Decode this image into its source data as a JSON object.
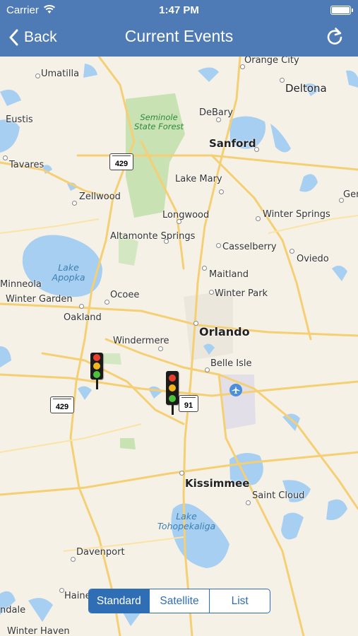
{
  "status_bar": {
    "carrier": "Carrier",
    "time": "1:47 PM"
  },
  "nav": {
    "back_label": "Back",
    "title": "Current Events"
  },
  "map": {
    "cities": {
      "orange_city": "Orange City",
      "deltona": "Deltona",
      "umatilla": "Umatilla",
      "eustis": "Eustis",
      "debary": "DeBary",
      "sanford": "Sanford",
      "tavares": "Tavares",
      "lake_mary": "Lake Mary",
      "zellwood": "Zellwood",
      "longwood": "Longwood",
      "winter_springs": "Winter Springs",
      "altamonte_springs": "Altamonte Springs",
      "casselberry": "Casselberry",
      "oviedo": "Oviedo",
      "maitland": "Maitland",
      "winter_park": "Winter Park",
      "ocoee": "Ocoee",
      "minneola": "Minneola",
      "winter_garden": "Winter Garden",
      "oakland": "Oakland",
      "orlando": "Orlando",
      "windermere": "Windermere",
      "belle_isle": "Belle Isle",
      "kissimmee": "Kissimmee",
      "saint_cloud": "Saint Cloud",
      "davenport": "Davenport",
      "haines": "Haine",
      "dale": "ndale",
      "winter_haven": "Winter Haven",
      "gen": "Gen"
    },
    "parks": {
      "seminole": "Seminole\nState Forest"
    },
    "waters": {
      "apopka": "Lake\nApopka",
      "toho": "Lake\nTohopekaliga"
    },
    "shields": {
      "s429_north": "429",
      "s429_west": "429",
      "s91": "91"
    }
  },
  "events": [
    {
      "name": "Traffic signal event",
      "lamps": [
        "#e8402f",
        "#f2b51c",
        "#4cc13c"
      ]
    },
    {
      "name": "Traffic signal event",
      "lamps": [
        "#e8402f",
        "#f2b51c",
        "#4cc13c"
      ]
    }
  ],
  "segmented": {
    "options": [
      "Standard",
      "Satellite",
      "List"
    ],
    "selected": "Standard"
  },
  "colors": {
    "nav": "#4e7bb5",
    "accent": "#2f6db5",
    "land": "#f6f1e6",
    "water": "#a6cff2",
    "road": "#f5cf74",
    "park": "#c8e2b4"
  }
}
